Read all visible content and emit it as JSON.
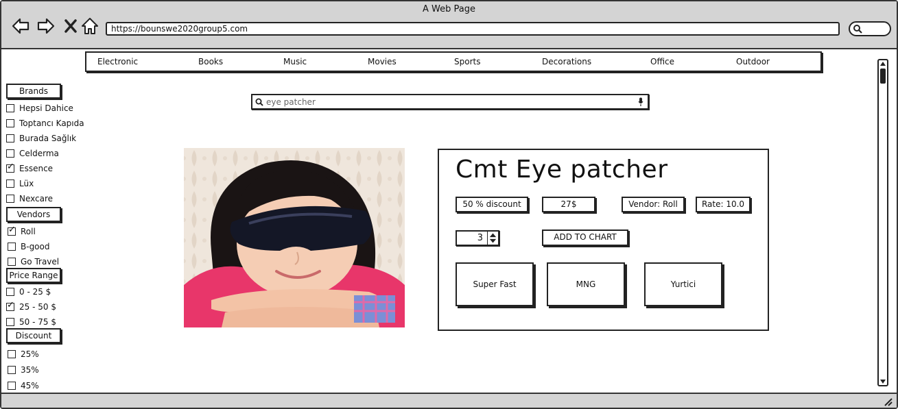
{
  "window": {
    "title": "A Web Page",
    "url": "https://bounswe2020group5.com"
  },
  "categories": [
    "Electronic",
    "Books",
    "Music",
    "Movies",
    "Sports",
    "Decorations",
    "Office",
    "Outdoor"
  ],
  "sidebar": {
    "brands": {
      "heading": "Brands",
      "items": [
        {
          "label": "Hepsi Dahice",
          "checked": false
        },
        {
          "label": "Toptancı Kapıda",
          "checked": false
        },
        {
          "label": "Burada Sağlık",
          "checked": false
        },
        {
          "label": "Celderma",
          "checked": false
        },
        {
          "label": "Essence",
          "checked": true
        },
        {
          "label": "Lüx",
          "checked": false
        },
        {
          "label": "Nexcare",
          "checked": false
        }
      ]
    },
    "vendors": {
      "heading": "Vendors",
      "items": [
        {
          "label": "Roll",
          "checked": true
        },
        {
          "label": "B-good",
          "checked": false
        },
        {
          "label": "Go Travel",
          "checked": false
        }
      ]
    },
    "price_range": {
      "heading": "Price Range",
      "items": [
        {
          "label": "0 - 25 $",
          "checked": false
        },
        {
          "label": "25 - 50 $",
          "checked": true
        },
        {
          "label": "50 - 75 $",
          "checked": false
        }
      ]
    },
    "discount": {
      "heading": "Discount",
      "items": [
        {
          "label": "25%",
          "checked": false
        },
        {
          "label": "35%",
          "checked": false
        },
        {
          "label": "45%",
          "checked": false
        }
      ]
    }
  },
  "search": {
    "value": "eye patcher"
  },
  "product": {
    "title": "Cmt Eye patcher",
    "discount": "50 % discount",
    "price": "27$",
    "vendor": "Vendor: Roll",
    "rate": "Rate: 10.0",
    "quantity": "3",
    "add_button": "ADD TO CHART",
    "shipping": [
      "Super Fast",
      "MNG",
      "Yurtici"
    ]
  },
  "icons": {
    "back": "back-arrow-icon",
    "forward": "forward-arrow-icon",
    "stop": "close-icon",
    "home": "home-icon",
    "search": "search-icon",
    "mic": "microphone-icon",
    "resize": "resize-grip-icon"
  }
}
